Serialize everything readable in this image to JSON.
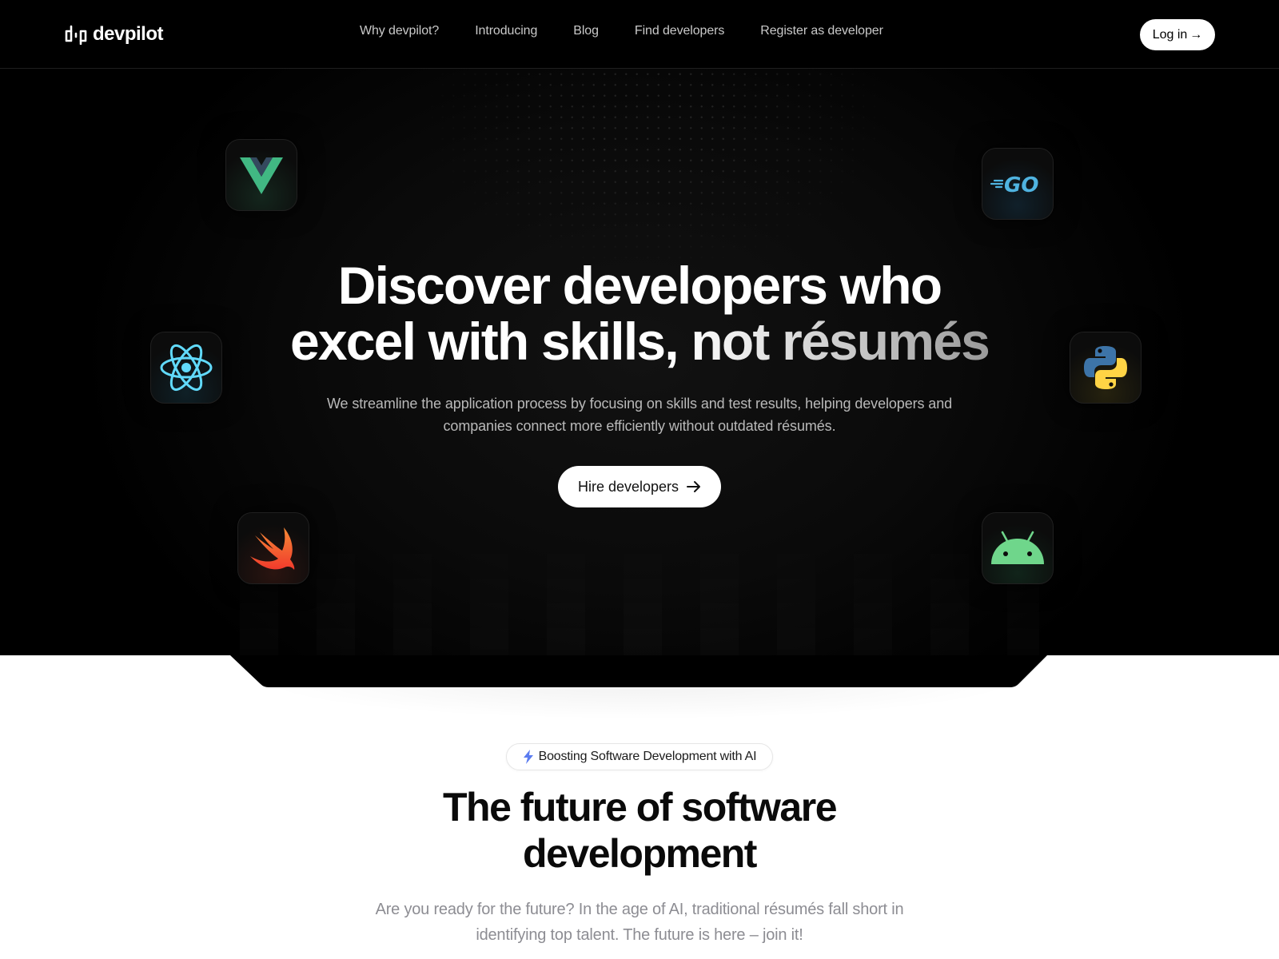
{
  "header": {
    "logo_text": "devpilot",
    "nav": [
      {
        "label": "Why devpilot?"
      },
      {
        "label": "Introducing"
      },
      {
        "label": "Blog"
      },
      {
        "label": "Find developers"
      },
      {
        "label": "Register as developer"
      }
    ],
    "login_label": "Log in",
    "login_icon": "arrow-right-icon"
  },
  "hero": {
    "title_line1": "Discover developers who",
    "title_line2_a": "excel with skills,",
    "title_line2_b": " not résumés",
    "subtitle": "We streamline the application process by focusing on skills and test results, helping developers and companies connect more efficiently without outdated résumés.",
    "cta_label": "Hire developers",
    "cta_icon": "arrow-right-icon",
    "tech_tiles": [
      {
        "name": "Vue",
        "icon": "vue-logo-icon",
        "color": "#41b883"
      },
      {
        "name": "Go",
        "icon": "go-logo-icon",
        "color": "#4fb3e0"
      },
      {
        "name": "React",
        "icon": "react-logo-icon",
        "color": "#61dafb"
      },
      {
        "name": "Python",
        "icon": "python-logo-icon",
        "color": "#3d74a8"
      },
      {
        "name": "Swift",
        "icon": "swift-logo-icon",
        "color": "#f05138"
      },
      {
        "name": "Android",
        "icon": "android-logo-icon",
        "color": "#6fd68b"
      }
    ]
  },
  "future": {
    "badge_icon": "lightning-icon",
    "badge_label": "Boosting Software Development with AI",
    "title_line1": "The future of software",
    "title_line2": "development",
    "subtitle": "Are you ready for the future? In the age of AI, traditional résumés fall short in identifying top talent. The future is here – join it!"
  },
  "colors": {
    "hero_bg": "#000000",
    "accent_badge_icon": "#5b7cf0",
    "text_muted": "#8d8d93"
  }
}
